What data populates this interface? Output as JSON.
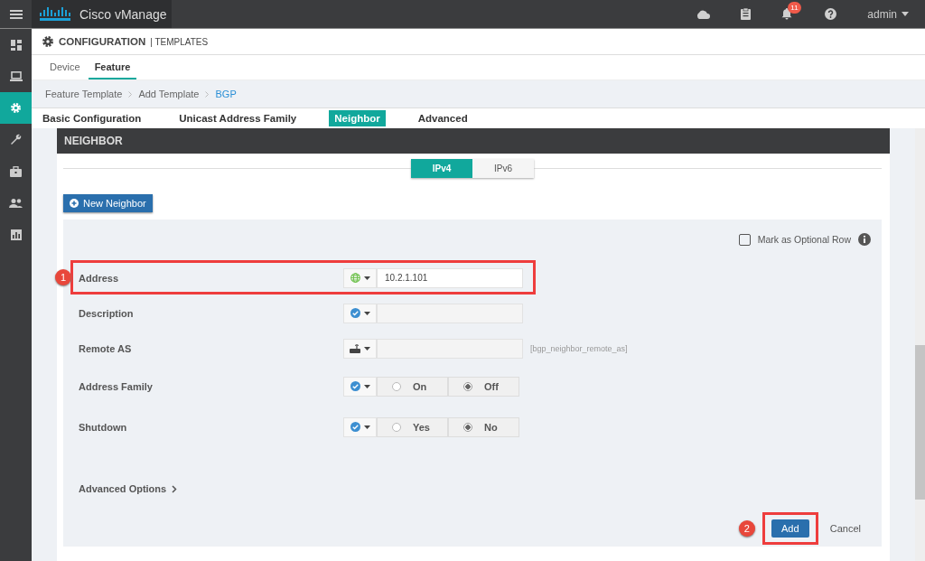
{
  "top_bar": {
    "product": "Cisco vManage",
    "notifications": "11",
    "user": "admin"
  },
  "sidebar": {
    "items": [
      {
        "selected": false
      },
      {
        "selected": false
      },
      {
        "selected": true
      },
      {
        "selected": false
      },
      {
        "selected": false
      },
      {
        "selected": false
      },
      {
        "selected": false
      }
    ]
  },
  "page_header": {
    "title": "CONFIGURATION",
    "subtitle": "| TEMPLATES"
  },
  "tabs": [
    {
      "label": "Device",
      "selected": false
    },
    {
      "label": "Feature",
      "selected": true
    }
  ],
  "breadcrumb": [
    {
      "label": "Feature Template",
      "current": false
    },
    {
      "label": "Add Template",
      "current": false
    },
    {
      "label": "BGP",
      "current": true
    }
  ],
  "section_tabs": [
    {
      "label": "Basic Configuration",
      "selected": false
    },
    {
      "label": "Unicast Address Family",
      "selected": false
    },
    {
      "label": "Neighbor",
      "selected": true
    },
    {
      "label": "Advanced",
      "selected": false
    }
  ],
  "panel": {
    "title": "NEIGHBOR",
    "ip_toggle": [
      {
        "label": "IPv4",
        "selected": true
      },
      {
        "label": "IPv6",
        "selected": false
      }
    ],
    "new_button": "New Neighbor",
    "optional_row": {
      "label": "Mark as Optional Row",
      "checked": false
    },
    "fields": [
      {
        "label": "Address",
        "scope": {
          "kind": "global"
        },
        "kind": "text",
        "value": "10.2.1.101",
        "highlight": "1"
      },
      {
        "label": "Description",
        "scope": {
          "kind": "default"
        },
        "kind": "text"
      },
      {
        "label": "Remote AS",
        "scope": {
          "kind": "device"
        },
        "kind": "text",
        "variable": "[bgp_neighbor_remote_as]"
      },
      {
        "label": "Address Family",
        "scope": {
          "kind": "default"
        },
        "kind": "radio",
        "options": [
          {
            "label": "On",
            "selected": false
          },
          {
            "label": "Off",
            "selected": true
          }
        ]
      },
      {
        "label": "Shutdown",
        "scope": {
          "kind": "default"
        },
        "kind": "radio",
        "options": [
          {
            "label": "Yes",
            "selected": false
          },
          {
            "label": "No",
            "selected": true
          }
        ]
      }
    ],
    "advanced_options": "Advanced Options",
    "add_button": {
      "label": "Add",
      "highlight": "2"
    },
    "cancel_button": "Cancel"
  }
}
